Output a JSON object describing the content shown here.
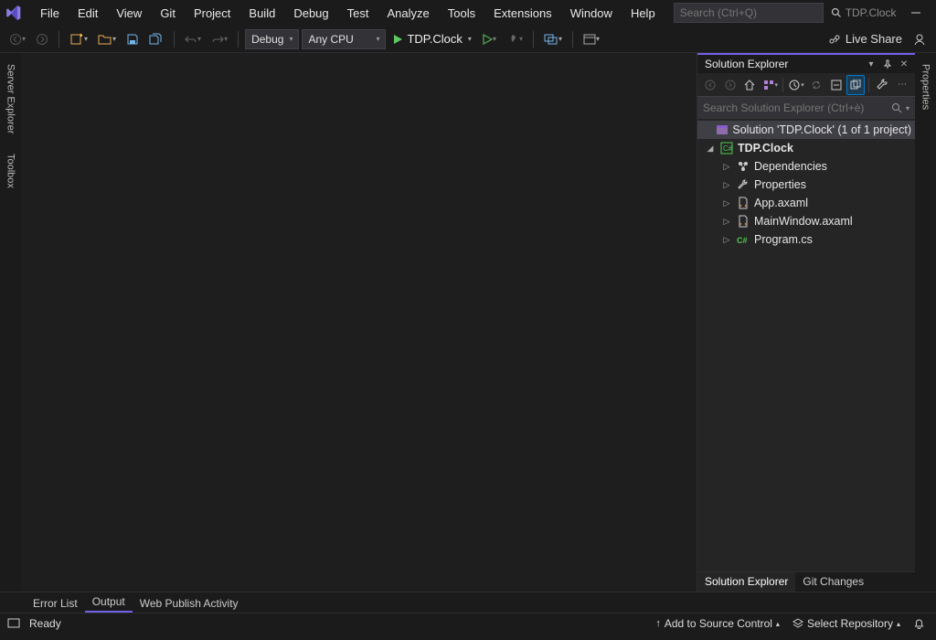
{
  "title": {
    "app_name": "TDP.Clock"
  },
  "menu": [
    "File",
    "Edit",
    "View",
    "Git",
    "Project",
    "Build",
    "Debug",
    "Test",
    "Analyze",
    "Tools",
    "Extensions",
    "Window",
    "Help"
  ],
  "search": {
    "placeholder": "Search (Ctrl+Q)"
  },
  "toolbar": {
    "config": "Debug",
    "platform": "Any CPU",
    "start_target": "TDP.Clock",
    "live_share": "Live Share"
  },
  "left_rail": {
    "server_explorer": "Server Explorer",
    "toolbox": "Toolbox"
  },
  "right_rail": {
    "properties": "Properties"
  },
  "solution_explorer": {
    "title": "Solution Explorer",
    "search_placeholder": "Search Solution Explorer (Ctrl+è)",
    "solution_label": "Solution 'TDP.Clock' (1 of 1 project)",
    "project": {
      "name": "TDP.Clock",
      "children": [
        {
          "label": "Dependencies",
          "icon": "dependencies"
        },
        {
          "label": "Properties",
          "icon": "properties"
        },
        {
          "label": "App.axaml",
          "icon": "axaml"
        },
        {
          "label": "MainWindow.axaml",
          "icon": "axaml"
        },
        {
          "label": "Program.cs",
          "icon": "cs"
        }
      ]
    },
    "tabs": {
      "active": "Solution Explorer",
      "other": "Git Changes"
    }
  },
  "bottom_tabs": [
    "Error List",
    "Output",
    "Web Publish Activity"
  ],
  "status": {
    "ready": "Ready",
    "add_src": "Add to Source Control",
    "select_repo": "Select Repository"
  }
}
